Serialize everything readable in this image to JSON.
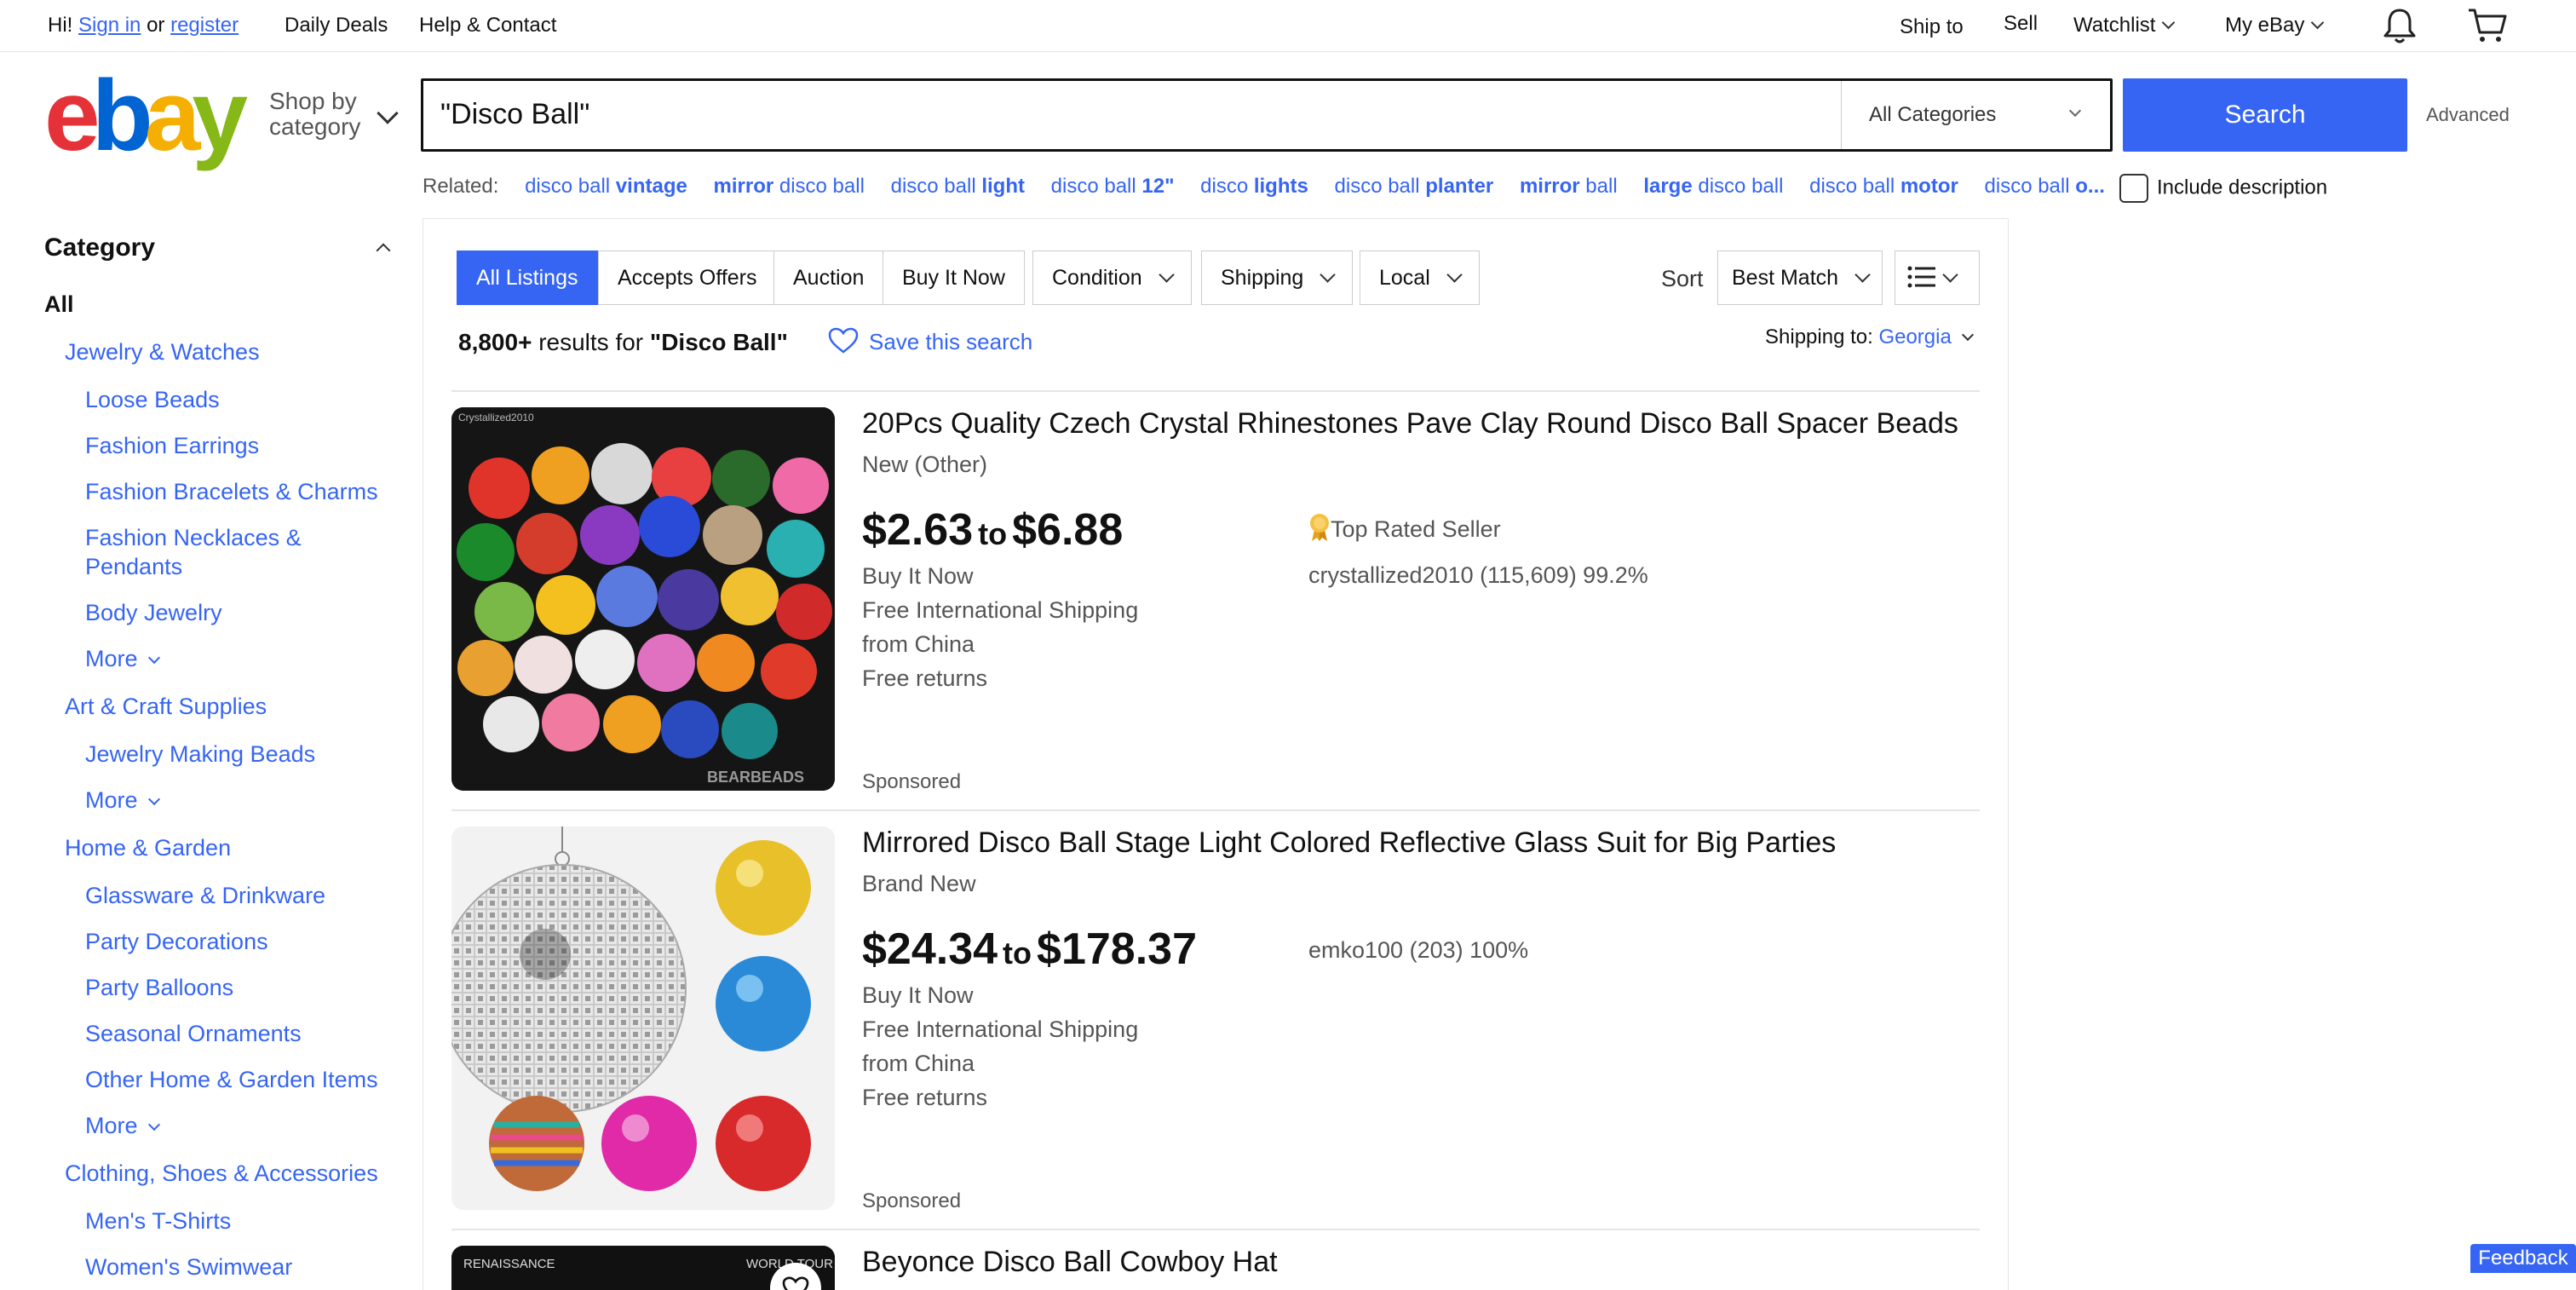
{
  "topbar": {
    "greeting": "Hi!",
    "sign_in": "Sign in",
    "or": "or",
    "register": "register",
    "daily_deals": "Daily Deals",
    "help": "Help & Contact",
    "ship_to": "Ship to",
    "sell": "Sell",
    "watchlist": "Watchlist",
    "my_ebay": "My eBay"
  },
  "header": {
    "logo": [
      "e",
      "b",
      "a",
      "y"
    ],
    "shop_by_line1": "Shop by",
    "shop_by_line2": "category",
    "search_value": "\"Disco Ball\"",
    "category_select": "All Categories",
    "search_button": "Search",
    "advanced": "Advanced"
  },
  "related": {
    "label": "Related:",
    "items": [
      {
        "plain": "disco ball ",
        "bold": "vintage",
        "plain_after": ""
      },
      {
        "plain": "",
        "bold": "mirror",
        "plain_after": " disco ball"
      },
      {
        "plain": "disco ball ",
        "bold": "light",
        "plain_after": ""
      },
      {
        "plain": "disco ball ",
        "bold": "12\"",
        "plain_after": ""
      },
      {
        "plain": "disco ",
        "bold": "lights",
        "plain_after": ""
      },
      {
        "plain": "disco ball ",
        "bold": "planter",
        "plain_after": ""
      },
      {
        "plain": "",
        "bold": "mirror",
        "plain_after": " ball"
      },
      {
        "plain": "",
        "bold": "large",
        "plain_after": " disco ball"
      },
      {
        "plain": "disco ball ",
        "bold": "motor",
        "plain_after": ""
      },
      {
        "plain": "disco ball ",
        "bold": "o...",
        "plain_after": ""
      }
    ],
    "include_description": "Include description"
  },
  "sidebar": {
    "heading": "Category",
    "all": "All",
    "jewelry": "Jewelry & Watches",
    "loose_beads": "Loose Beads",
    "fashion_earrings": "Fashion Earrings",
    "fashion_bracelets": "Fashion Bracelets & Charms",
    "fashion_necklaces_1": "Fashion Necklaces &",
    "fashion_necklaces_2": "Pendants",
    "body_jewelry": "Body Jewelry",
    "more": "More",
    "art_craft": "Art & Craft Supplies",
    "jewelry_making": "Jewelry Making Beads",
    "home_garden": "Home & Garden",
    "glassware": "Glassware & Drinkware",
    "party_decorations": "Party Decorations",
    "party_balloons": "Party Balloons",
    "seasonal": "Seasonal Ornaments",
    "other_home": "Other Home & Garden Items",
    "clothing": "Clothing, Shoes & Accessories",
    "mens_tshirts": "Men's T-Shirts",
    "womens_swimwear": "Women's Swimwear"
  },
  "filters": {
    "all_listings": "All Listings",
    "accepts_offers": "Accepts Offers",
    "auction": "Auction",
    "buy_it_now": "Buy It Now",
    "condition": "Condition",
    "shipping": "Shipping",
    "local": "Local",
    "sort_label": "Sort",
    "sort_value": "Best Match"
  },
  "results": {
    "count": "8,800+",
    "count_text": "results for",
    "query": "\"Disco Ball\"",
    "save_search": "Save this search",
    "shipping_to": "Shipping to:",
    "shipping_location": "Georgia"
  },
  "listings": [
    {
      "title": "20Pcs Quality Czech Crystal Rhinestones Pave Clay Round Disco Ball Spacer Beads",
      "condition": "New (Other)",
      "price_low": "$2.63",
      "price_to": "to",
      "price_high": "$6.88",
      "format": "Buy It Now",
      "shipping": "Free International Shipping",
      "origin": "from China",
      "returns": "Free returns",
      "top_rated": "Top Rated Seller",
      "seller": "crystallized2010 (115,609) 99.2%",
      "sponsored": "Sponsored",
      "watermark_top": "Crystallized2010",
      "watermark_bottom": "BEARBEADS"
    },
    {
      "title": "Mirrored Disco Ball Stage Light Colored Reflective Glass Suit for Big Parties",
      "condition": "Brand New",
      "price_low": "$24.34",
      "price_to": "to",
      "price_high": "$178.37",
      "format": "Buy It Now",
      "shipping": "Free International Shipping",
      "origin": "from China",
      "returns": "Free returns",
      "seller": "emko100 (203) 100%",
      "sponsored": "Sponsored"
    },
    {
      "title": "Beyonce Disco Ball Cowboy Hat",
      "thumb_left_text": "RENAISSANCE",
      "thumb_right_text": "WORLD TOUR"
    }
  ],
  "feedback": "Feedback"
}
